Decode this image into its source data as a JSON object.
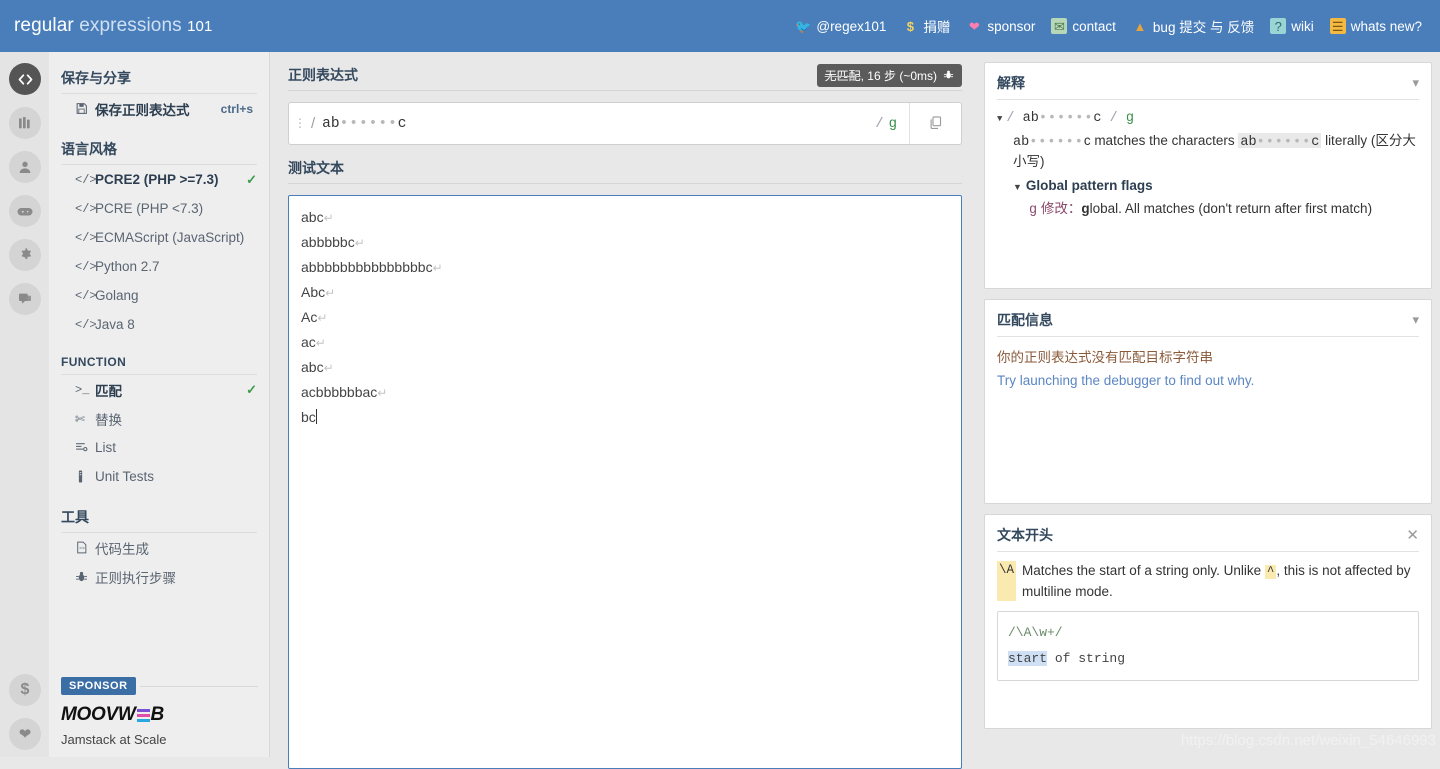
{
  "header": {
    "logo_bold": "regular",
    "logo_light": "expressions",
    "logo_num": "101",
    "nav": [
      {
        "icon": "twitter-icon",
        "label": "@regex101"
      },
      {
        "icon": "dollar-icon",
        "label": "捐赠"
      },
      {
        "icon": "heart-icon",
        "label": "sponsor"
      },
      {
        "icon": "mail-icon",
        "label": "contact"
      },
      {
        "icon": "warning-icon",
        "label": "bug 提交 与 反馈"
      },
      {
        "icon": "wiki-icon",
        "label": "wiki"
      },
      {
        "icon": "news-icon",
        "label": "whats new?"
      }
    ]
  },
  "rail": {
    "items": [
      {
        "icon": "code-icon",
        "active": true
      },
      {
        "icon": "library-icon",
        "active": false
      },
      {
        "icon": "account-icon",
        "active": false
      },
      {
        "icon": "gamepad-icon",
        "active": false
      },
      {
        "icon": "gear-icon",
        "active": false
      },
      {
        "icon": "community-icon",
        "active": false
      }
    ],
    "bottom": [
      {
        "icon": "dollar-icon"
      },
      {
        "icon": "heart-icon"
      }
    ]
  },
  "sidebar": {
    "save_section_title": "保存与分享",
    "save_item": {
      "label": "保存正则表达式",
      "shortcut": "ctrl+s",
      "icon": "save-icon"
    },
    "flavor_section_title": "语言风格",
    "flavors": [
      {
        "label": "PCRE2 (PHP >=7.3)",
        "selected": true
      },
      {
        "label": "PCRE (PHP <7.3)",
        "selected": false
      },
      {
        "label": "ECMAScript (JavaScript)",
        "selected": false
      },
      {
        "label": "Python 2.7",
        "selected": false
      },
      {
        "label": "Golang",
        "selected": false
      },
      {
        "label": "Java 8",
        "selected": false
      }
    ],
    "function_section_title": "FUNCTION",
    "functions": [
      {
        "label": "匹配",
        "icon": "terminal-icon",
        "selected": true
      },
      {
        "label": "替换",
        "icon": "scissors-icon",
        "selected": false
      },
      {
        "label": "List",
        "icon": "list-icon",
        "selected": false
      },
      {
        "label": "Unit Tests",
        "icon": "flask-icon",
        "selected": false
      }
    ],
    "tools_section_title": "工具",
    "tools": [
      {
        "label": "代码生成",
        "icon": "code-file-icon"
      },
      {
        "label": "正则执行步骤",
        "icon": "bug-icon"
      }
    ],
    "sponsor": {
      "badge": "SPONSOR",
      "brand_left": "MOOVW",
      "brand_right": "B",
      "tagline": "Jamstack at Scale"
    }
  },
  "regex_panel": {
    "title": "正则表达式",
    "badge": {
      "status": "无匹配",
      "rest": ", 16 步 (~0ms)",
      "icon": "bug-icon"
    },
    "pattern_prefix": "ab",
    "pattern_dots": "••••••",
    "pattern_suffix": "c",
    "delimiter": "/",
    "flags": "g",
    "copy_icon": "copy-icon"
  },
  "test_panel": {
    "title": "测试文本",
    "lines": [
      "abc",
      "abbbbbc",
      "abbbbbbbbbbbbbbbc",
      "Abc",
      "Ac",
      "ac",
      "abc",
      "acbbbbbbac",
      "bc"
    ],
    "pilcrow": "↵"
  },
  "explanation": {
    "title": "解释",
    "chevron": "chevron-down-icon",
    "line1_prefix": "ab",
    "line1_dots": "••••••",
    "line1_suffix": "c",
    "line1_flag": "g",
    "line2_a": "ab",
    "line2_dots": "••••••",
    "line2_b": "c matches the characters ",
    "line2_hl_a": "ab",
    "line2_hl_dots": "••••••",
    "line2_hl_b": "c",
    "line2_c": " literally (区分大小写)",
    "flags_title": "Global pattern flags",
    "flag_letter": "g",
    "flag_label": "修改：",
    "flag_desc_bold": "g",
    "flag_desc": "lobal. All matches (don't return after first match)"
  },
  "match_info": {
    "title": "匹配信息",
    "chevron": "chevron-down-icon",
    "warning": "你的正则表达式没有匹配目标字符串",
    "link": "Try launching the debugger to find out why."
  },
  "quick_ref": {
    "title": "文本开头",
    "close": "close-icon",
    "token": "\\A",
    "desc_a": "Matches the start of a string only. Unlike ",
    "token2": "^",
    "desc_b": ", this is not affected by multiline mode.",
    "example_pattern": "/\\A\\w+/",
    "example_sel": "start",
    "example_rest": " of string"
  },
  "watermark": "https://blog.csdn.net/weixin_54646993",
  "colors": {
    "brand_blue": "#4a7ebb",
    "heading": "#34495e",
    "badge_gray": "#5b5b5b",
    "check_green": "#3a9d4a",
    "link_blue": "#5b86c4",
    "warn_brown": "#8a5a3a",
    "token_yellow": "#fbeab0",
    "sponsor_badge": "#3b6ea5"
  }
}
